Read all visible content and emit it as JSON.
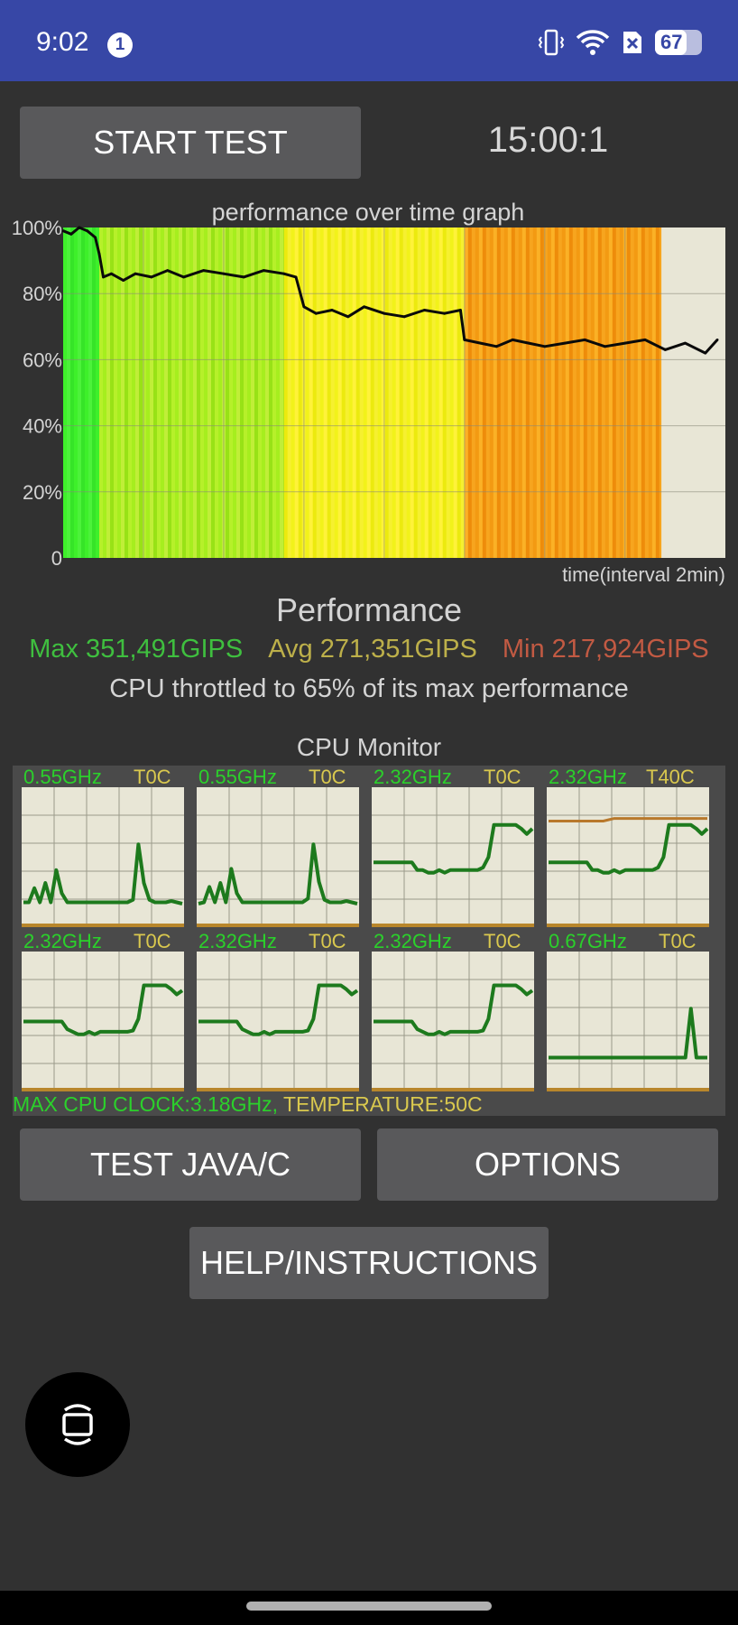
{
  "status_bar": {
    "time": "9:02",
    "notification_count": "1",
    "battery_level": "67",
    "battery_fraction": 0.67,
    "icons": [
      "vibrate-icon",
      "wifi-icon",
      "sim-off-icon",
      "battery-icon"
    ]
  },
  "toolbar": {
    "start_label": "START TEST",
    "timer": "15:00:1"
  },
  "chart_data": {
    "type": "line",
    "title": "performance over time graph",
    "xlabel": "time(interval 2min)",
    "ylabel": "",
    "yticks": [
      "0",
      "20%",
      "40%",
      "60%",
      "80%",
      "100%"
    ],
    "ylim": [
      0,
      100
    ],
    "xlim": [
      0,
      16.5
    ],
    "grid": true,
    "series": [
      {
        "x": [
          0,
          0.2,
          0.4,
          0.6,
          0.8,
          0.9,
          1.0,
          1.2,
          1.5,
          1.8,
          2.2,
          2.6,
          3.0,
          3.5,
          4.0,
          4.5,
          5.0,
          5.5,
          5.8,
          6.0,
          6.3,
          6.7,
          7.1,
          7.5,
          8.0,
          8.5,
          9.0,
          9.5,
          9.9,
          10.0,
          10.4,
          10.8,
          11.2,
          11.6,
          12.0,
          12.5,
          13.0,
          13.5,
          14.0,
          14.5,
          15.0,
          15.5,
          16.0,
          16.3
        ],
        "values": [
          99,
          98,
          100,
          99,
          97,
          92,
          85,
          86,
          84,
          86,
          85,
          87,
          85,
          87,
          86,
          85,
          87,
          86,
          85,
          76,
          74,
          75,
          73,
          76,
          74,
          73,
          75,
          74,
          75,
          66,
          65,
          64,
          66,
          65,
          64,
          65,
          66,
          64,
          65,
          66,
          63,
          65,
          62,
          66
        ]
      }
    ],
    "bands": [
      {
        "from": 0,
        "to": 0.9,
        "level": "max"
      },
      {
        "from": 0.9,
        "to": 5.5,
        "level": "high"
      },
      {
        "from": 5.5,
        "to": 10.0,
        "level": "medium"
      },
      {
        "from": 10.0,
        "to": 14.9,
        "level": "low"
      }
    ],
    "colors": {
      "max": "#3ef02a",
      "high": "#a6ee1e",
      "medium": "#f2f21a",
      "low": "#f39a12",
      "line": "#0a0a0a",
      "plot_bg": "#e8e6d6"
    }
  },
  "performance": {
    "heading": "Performance",
    "max": "Max 351,491GIPS",
    "avg": "Avg 271,351GIPS",
    "min": "Min 217,924GIPS",
    "throttle": "CPU throttled to 65% of its max performance"
  },
  "cpu_monitor": {
    "title": "CPU Monitor",
    "cores": [
      {
        "freq": "0.55GHz",
        "temp": "T0C",
        "values": [
          0.15,
          0.15,
          0.26,
          0.15,
          0.3,
          0.15,
          0.4,
          0.22,
          0.15,
          0.15,
          0.15,
          0.15,
          0.15,
          0.15,
          0.15,
          0.15,
          0.15,
          0.15,
          0.15,
          0.15,
          0.17,
          0.6,
          0.3,
          0.17,
          0.15,
          0.15,
          0.15,
          0.16,
          0.15,
          0.14
        ]
      },
      {
        "freq": "0.55GHz",
        "temp": "T0C",
        "values": [
          0.14,
          0.15,
          0.27,
          0.15,
          0.3,
          0.15,
          0.41,
          0.22,
          0.15,
          0.15,
          0.15,
          0.15,
          0.15,
          0.15,
          0.15,
          0.15,
          0.15,
          0.15,
          0.15,
          0.15,
          0.18,
          0.6,
          0.31,
          0.17,
          0.15,
          0.15,
          0.15,
          0.16,
          0.15,
          0.14
        ]
      },
      {
        "freq": "2.32GHz",
        "temp": "T0C",
        "values": [
          0.46,
          0.46,
          0.46,
          0.46,
          0.46,
          0.46,
          0.46,
          0.46,
          0.4,
          0.4,
          0.38,
          0.38,
          0.4,
          0.38,
          0.4,
          0.4,
          0.4,
          0.4,
          0.4,
          0.4,
          0.42,
          0.5,
          0.75,
          0.75,
          0.75,
          0.75,
          0.75,
          0.72,
          0.68,
          0.72
        ]
      },
      {
        "freq": "2.32GHz",
        "temp": "T40C",
        "values": [
          0.46,
          0.46,
          0.46,
          0.46,
          0.46,
          0.46,
          0.46,
          0.46,
          0.4,
          0.4,
          0.38,
          0.38,
          0.4,
          0.38,
          0.4,
          0.4,
          0.4,
          0.4,
          0.4,
          0.4,
          0.42,
          0.5,
          0.75,
          0.75,
          0.75,
          0.75,
          0.75,
          0.72,
          0.68,
          0.72
        ]
      },
      {
        "freq": "2.32GHz",
        "temp": "T0C",
        "values": [
          0.5,
          0.5,
          0.5,
          0.5,
          0.5,
          0.5,
          0.5,
          0.5,
          0.44,
          0.42,
          0.4,
          0.4,
          0.42,
          0.4,
          0.42,
          0.42,
          0.42,
          0.42,
          0.42,
          0.42,
          0.43,
          0.52,
          0.78,
          0.78,
          0.78,
          0.78,
          0.78,
          0.75,
          0.71,
          0.74
        ]
      },
      {
        "freq": "2.32GHz",
        "temp": "T0C",
        "values": [
          0.5,
          0.5,
          0.5,
          0.5,
          0.5,
          0.5,
          0.5,
          0.5,
          0.44,
          0.42,
          0.4,
          0.4,
          0.42,
          0.4,
          0.42,
          0.42,
          0.42,
          0.42,
          0.42,
          0.42,
          0.43,
          0.52,
          0.78,
          0.78,
          0.78,
          0.78,
          0.78,
          0.75,
          0.71,
          0.74
        ]
      },
      {
        "freq": "2.32GHz",
        "temp": "T0C",
        "values": [
          0.5,
          0.5,
          0.5,
          0.5,
          0.5,
          0.5,
          0.5,
          0.5,
          0.44,
          0.42,
          0.4,
          0.4,
          0.42,
          0.4,
          0.42,
          0.42,
          0.42,
          0.42,
          0.42,
          0.42,
          0.43,
          0.52,
          0.78,
          0.78,
          0.78,
          0.78,
          0.78,
          0.75,
          0.71,
          0.74
        ]
      },
      {
        "freq": "0.67GHz",
        "temp": "T0C",
        "values": [
          0.22,
          0.22,
          0.22,
          0.22,
          0.22,
          0.22,
          0.22,
          0.22,
          0.22,
          0.22,
          0.22,
          0.22,
          0.22,
          0.22,
          0.22,
          0.22,
          0.22,
          0.22,
          0.22,
          0.22,
          0.22,
          0.22,
          0.22,
          0.22,
          0.22,
          0.22,
          0.6,
          0.22,
          0.22,
          0.22
        ]
      }
    ],
    "temp_trace": [
      0.78,
      0.78,
      0.78,
      0.78,
      0.78,
      0.78,
      0.78,
      0.78,
      0.78,
      0.78,
      0.78,
      0.79,
      0.8,
      0.8,
      0.8,
      0.8,
      0.8,
      0.8,
      0.8,
      0.8,
      0.8,
      0.8,
      0.8,
      0.8,
      0.8,
      0.8,
      0.8,
      0.8,
      0.8,
      0.8
    ],
    "footer_clock": "MAX CPU CLOCK:3.18GHz, ",
    "footer_temp": "TEMPERATURE:50C",
    "colors": {
      "line": "#1d7a1d",
      "baseline": "#b8862b",
      "temp_line": "#b8782b",
      "plot_bg": "#e8e6d6"
    }
  },
  "actions": {
    "java_label": "TEST JAVA/C",
    "options_label": "OPTIONS",
    "help_label": "HELP/INSTRUCTIONS"
  },
  "floating_button": {
    "icon": "screen-rotate-icon"
  }
}
